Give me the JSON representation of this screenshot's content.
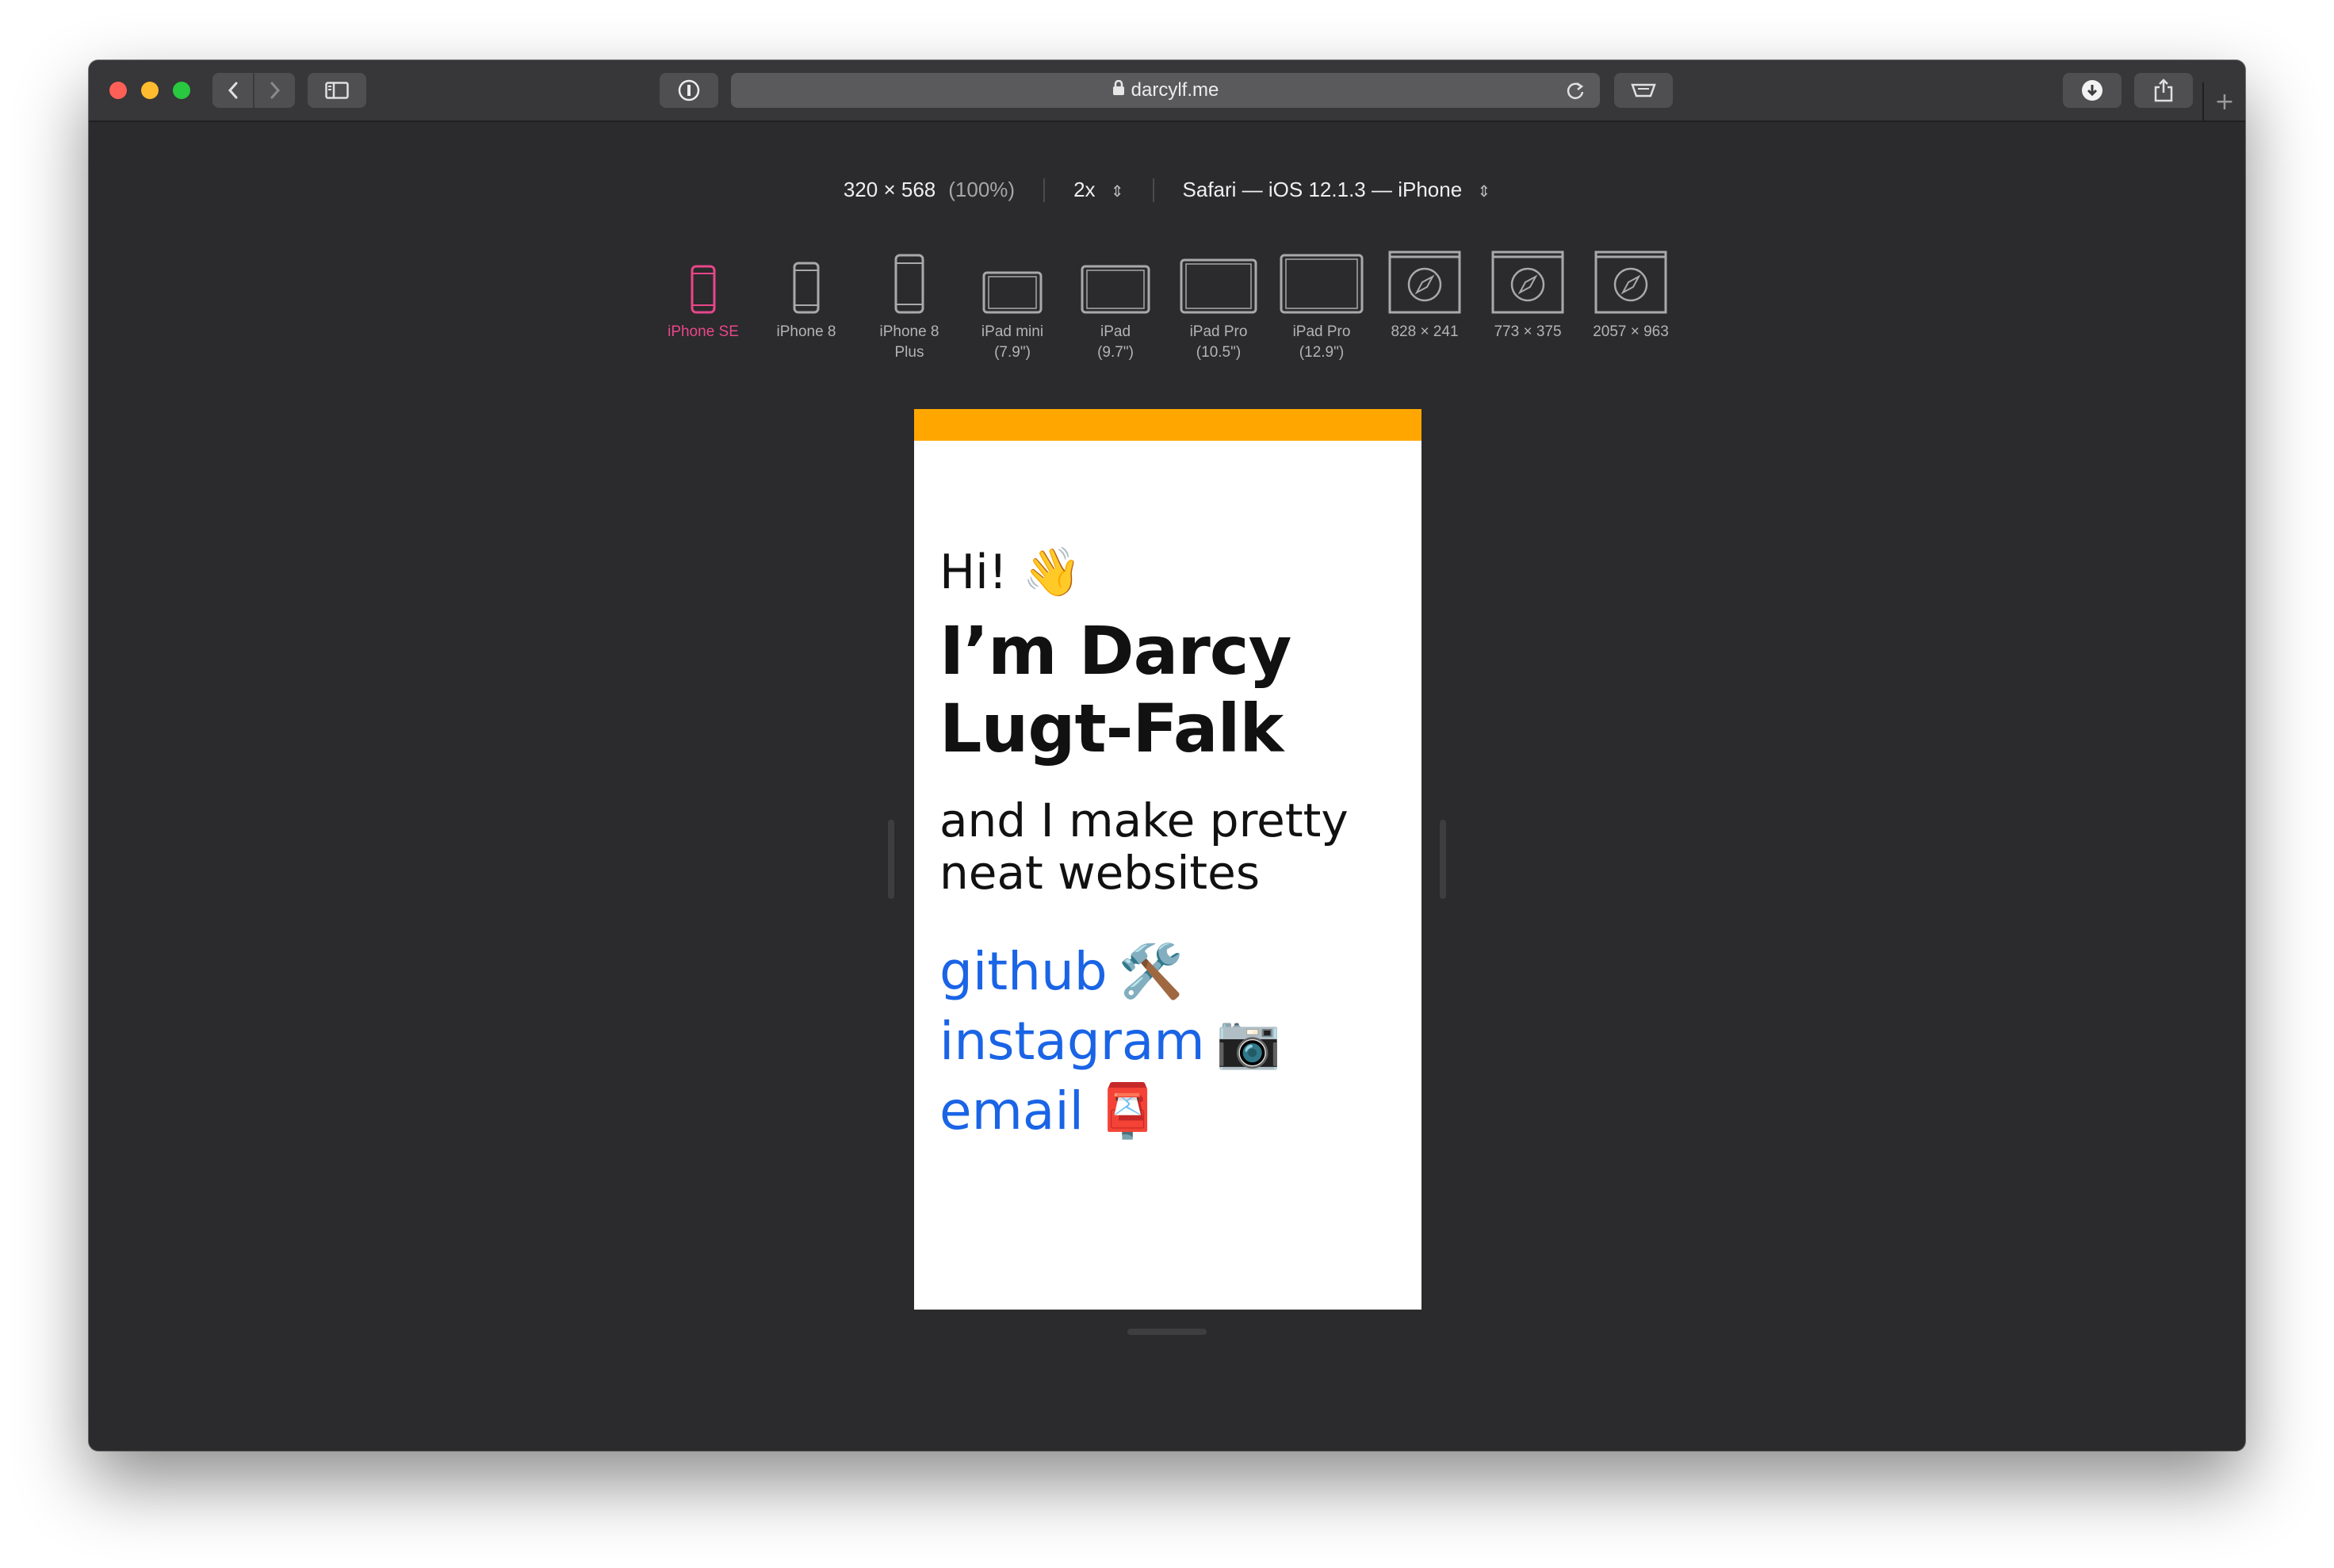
{
  "browser": {
    "url": "darcylf.me",
    "new_tab_label": "+"
  },
  "responsive_toolbar": {
    "dimensions": "320 × 568",
    "zoom_percent": "(100%)",
    "pixel_ratio": "2x",
    "user_agent": "Safari — iOS 12.1.3 — iPhone",
    "chooser_arrows": "⌃⌄"
  },
  "devices": [
    {
      "label": "iPhone SE",
      "active": true,
      "icon": "phone-small-icon"
    },
    {
      "label": "iPhone 8",
      "active": false,
      "icon": "phone-icon"
    },
    {
      "label": "iPhone 8\nPlus",
      "active": false,
      "icon": "phone-large-icon"
    },
    {
      "label": "iPad mini\n(7.9\")",
      "active": false,
      "icon": "tablet-small-icon"
    },
    {
      "label": "iPad\n(9.7\")",
      "active": false,
      "icon": "tablet-icon"
    },
    {
      "label": "iPad Pro\n(10.5\")",
      "active": false,
      "icon": "tablet-large-icon"
    },
    {
      "label": "iPad Pro\n(12.9\")",
      "active": false,
      "icon": "tablet-xl-icon"
    },
    {
      "label": "828 × 241",
      "active": false,
      "icon": "safari-window-icon"
    },
    {
      "label": "773 × 375",
      "active": false,
      "icon": "safari-window-icon"
    },
    {
      "label": "2057 × 963",
      "active": false,
      "icon": "safari-window-icon"
    }
  ],
  "page": {
    "greeting": "Hi! 👋",
    "name_line1": "I’m Darcy",
    "name_line2": "Lugt-Falk",
    "tagline_line1": "and I make pretty",
    "tagline_line2": "neat websites",
    "links": [
      {
        "text": "github",
        "emoji": "🛠️"
      },
      {
        "text": "instagram",
        "emoji": "📷"
      },
      {
        "text": "email",
        "emoji": "📮"
      }
    ]
  },
  "colors": {
    "accent_bar": "#ffa700",
    "link": "#1a64e6",
    "active_device": "#e8478a"
  }
}
